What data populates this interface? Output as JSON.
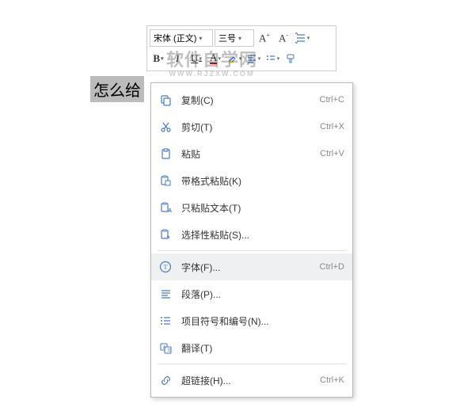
{
  "toolbar": {
    "font_name": "宋体 (正文)",
    "font_size": "三号"
  },
  "document": {
    "selected_text": "怎么给",
    "watermark_main": "软件自学网",
    "watermark_sub": "WWW.RJZXW.COM"
  },
  "menu": {
    "items": [
      {
        "icon": "copy",
        "label": "复制(C)",
        "shortcut": "Ctrl+C"
      },
      {
        "icon": "cut",
        "label": "剪切(T)",
        "shortcut": "Ctrl+X"
      },
      {
        "icon": "paste",
        "label": "粘贴",
        "shortcut": "Ctrl+V"
      },
      {
        "icon": "paste-format",
        "label": "带格式粘贴(K)",
        "shortcut": ""
      },
      {
        "icon": "paste-text",
        "label": "只粘贴文本(T)",
        "shortcut": ""
      },
      {
        "icon": "paste-special",
        "label": "选择性粘贴(S)...",
        "shortcut": ""
      },
      {
        "icon": "font",
        "label": "字体(F)...",
        "shortcut": "Ctrl+D",
        "highlighted": true
      },
      {
        "icon": "paragraph",
        "label": "段落(P)...",
        "shortcut": ""
      },
      {
        "icon": "bullets",
        "label": "项目符号和编号(N)...",
        "shortcut": ""
      },
      {
        "icon": "translate",
        "label": "翻译(T)",
        "shortcut": ""
      },
      {
        "icon": "hyperlink",
        "label": "超链接(H)...",
        "shortcut": "Ctrl+K"
      }
    ]
  }
}
